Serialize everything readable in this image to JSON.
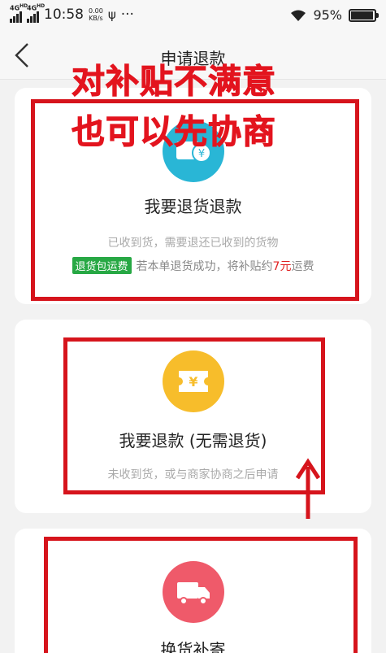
{
  "status_bar": {
    "network_1": "4G",
    "network_1_sub": "HD",
    "network_2": "4G",
    "network_2_sub": "HD",
    "time": "10:58",
    "speed_value": "0.00",
    "speed_unit": "KB/s",
    "usb_icon": "usb-icon",
    "more": "···",
    "battery": "95%",
    "battery_level": 0.95
  },
  "nav": {
    "back_icon": "chevron-left-icon",
    "title": "申请退款"
  },
  "overlay_text": {
    "line1": "对补贴不满意",
    "line2": "也可以先协商"
  },
  "options": [
    {
      "icon": "refund-package-icon",
      "icon_glyph": "¥",
      "icon_color": "#29b6d6",
      "title": "我要退货退款",
      "desc": "已收到货，需要退还已收到的货物",
      "badge": "退货包运费",
      "note_prefix": "若本单退货成功，将补贴约",
      "note_amount": "7元",
      "note_suffix": "运费"
    },
    {
      "icon": "coupon-yen-icon",
      "icon_glyph": "¥",
      "icon_color": "#f7bd2b",
      "title": "我要退款 (无需退货)",
      "desc": "未收到货，或与商家协商之后申请"
    },
    {
      "icon": "delivery-truck-icon",
      "icon_color": "#ef5a6a",
      "title": "换货补寄"
    }
  ],
  "colors": {
    "annotation_red": "#d6141c",
    "badge_green": "#27a844"
  }
}
